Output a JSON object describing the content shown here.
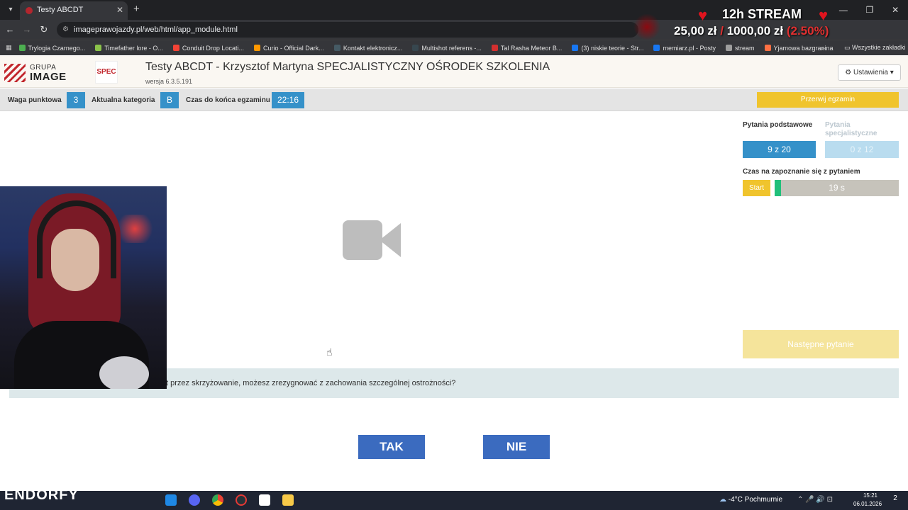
{
  "browser": {
    "tab_title": "Testy ABCDT",
    "url": "imageprawojazdy.pl/web/html/app_module.html",
    "bookmarks": [
      {
        "label": "Trylogia Czarnego...",
        "color": "#4caf50"
      },
      {
        "label": "Timefather lore - O...",
        "color": "#8bc34a"
      },
      {
        "label": "Conduit Drop Locati...",
        "color": "#f44336"
      },
      {
        "label": "Curio - Official Dark...",
        "color": "#ff9800"
      },
      {
        "label": "Kontakt elektronicz...",
        "color": "#455a64"
      },
      {
        "label": "Multishot referens -...",
        "color": "#37474f"
      },
      {
        "label": "Tal Rasha Meteor B...",
        "color": "#d32f2f"
      },
      {
        "label": "(3) niskie teorie - Str...",
        "color": "#1877f2"
      },
      {
        "label": "memiarz.pl - Posty",
        "color": "#1877f2"
      },
      {
        "label": "stream",
        "color": "#9e9e9e"
      },
      {
        "label": "Yjamowa bazgranina",
        "color": "#ff7043"
      }
    ],
    "all_bookmarks": "Wszystkie zakładki"
  },
  "stream_overlay": {
    "title": "12h STREAM",
    "amount_current": "25,00 zł",
    "separator": "/",
    "amount_goal": "1000,00 zł",
    "percent": "(2.50%)"
  },
  "app": {
    "brand_small": "GRUPA",
    "brand_big": "IMAGE",
    "spec_logo": "SPEC",
    "title": "Testy ABCDT - Krzysztof Martyna SPECJALISTYCZNY OŚRODEK SZKOLENIA",
    "version": "wersja 6.3.5.191",
    "settings_label": "Ustawienia"
  },
  "info_bar": {
    "weight_label": "Waga punktowa",
    "weight_value": "3",
    "category_label": "Aktualna kategoria",
    "category_value": "B",
    "time_label": "Czas do końca egzaminu",
    "time_value": "22:16",
    "stop_label": "Przerwij egzamin"
  },
  "panel": {
    "basic_label": "Pytania podstawowe",
    "basic_count": "9 z 20",
    "spec_label": "Pytania specjalistyczne",
    "spec_count": "0 z 12",
    "reading_time_label": "Czas na zapoznanie się z pytaniem",
    "start_label": "Start",
    "timer_text": "19 s",
    "timer_fraction": 0.05,
    "next_label": "Następne pytanie"
  },
  "question": {
    "text": "t przez skrzyżowanie, możesz zrezygnować z zachowania szczególnej ostrożności?"
  },
  "answers": {
    "yes": "TAK",
    "no": "NIE"
  },
  "taskbar": {
    "brand": "ENDORFY",
    "weather": "-4°C  Pochmurnie",
    "time": "15:21",
    "date": "06.01.2026",
    "notifications": "2"
  },
  "colors": {
    "accent_blue": "#3591c9",
    "accent_yellow": "#f0c42d",
    "answer_blue": "#3b6bbf",
    "question_bg": "#dde8ea",
    "timer_green": "#21c07a"
  }
}
